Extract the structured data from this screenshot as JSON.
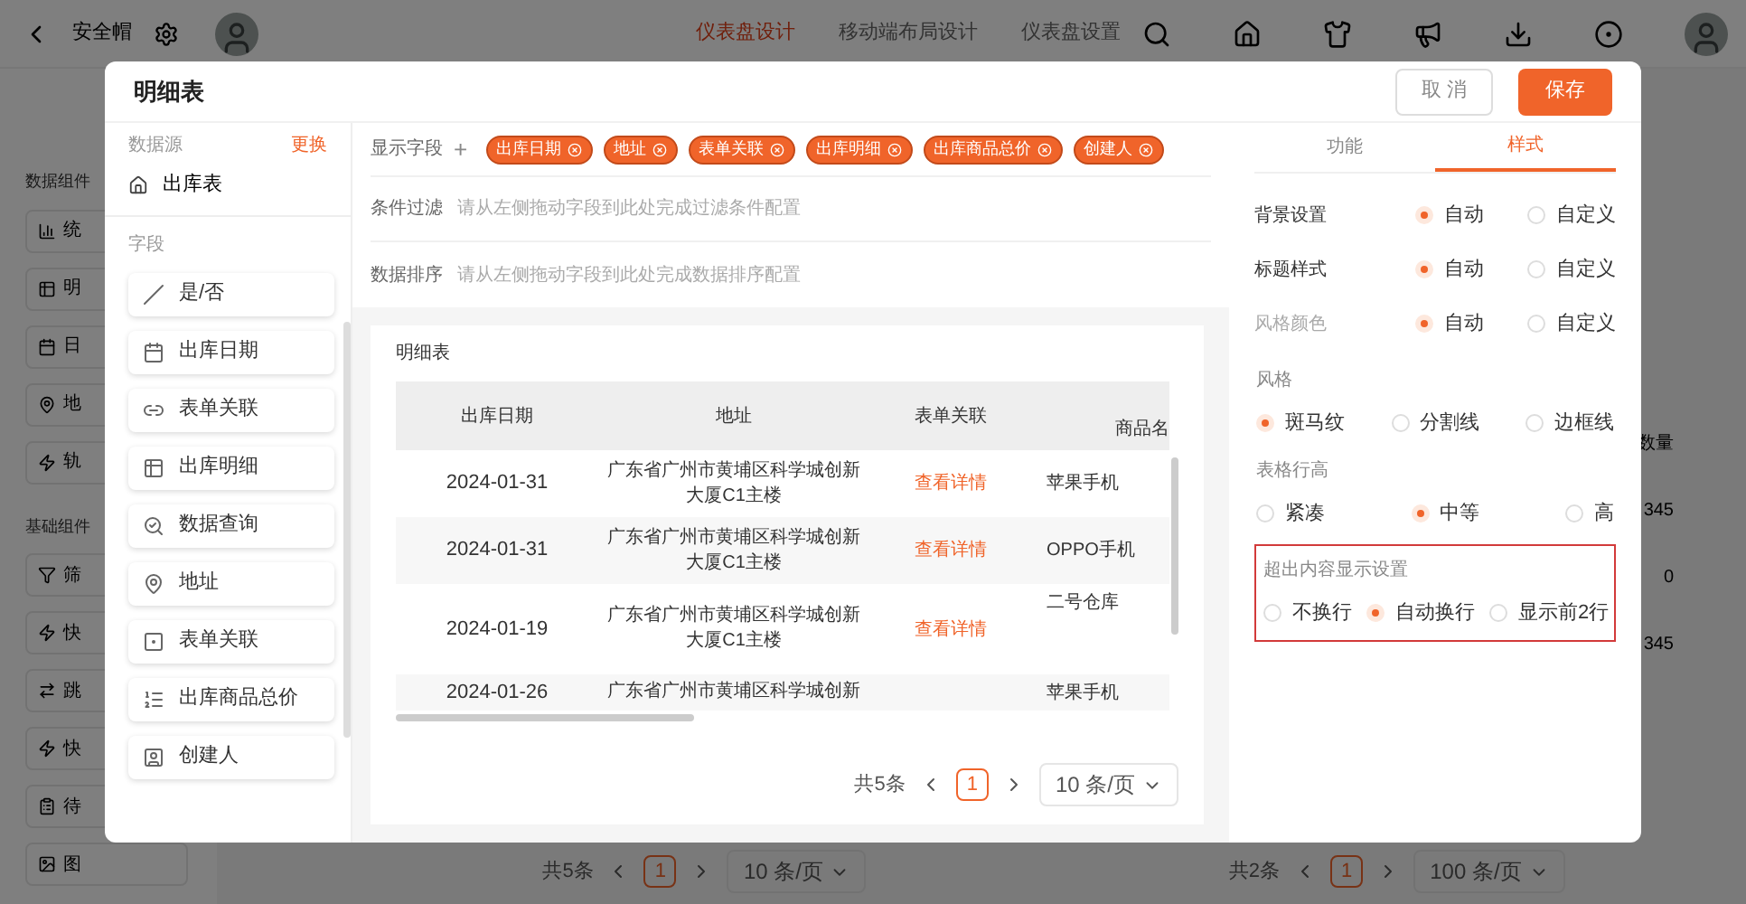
{
  "top_bar": {
    "title": "安全帽",
    "tabs": [
      {
        "label": "仪表盘设计",
        "selected": true
      },
      {
        "label": "移动端布局设计",
        "selected": false
      },
      {
        "label": "仪表盘设置",
        "selected": false
      }
    ]
  },
  "background_sidebar": {
    "sections": [
      {
        "title": "数据组件",
        "items": [
          "统",
          "明",
          "日",
          "地",
          "轨"
        ]
      },
      {
        "title": "基础组件",
        "items": [
          "筛",
          "快",
          "跳",
          "快",
          "待",
          "图"
        ]
      }
    ]
  },
  "background_table": {
    "column_header": "数量",
    "values": [
      "345",
      "0",
      "345"
    ]
  },
  "background_paginations": [
    {
      "total": "共5条",
      "page": "1",
      "size": "10 条/页"
    },
    {
      "total": "共2条",
      "page": "1",
      "size": "100 条/页"
    }
  ],
  "modal": {
    "title": "明细表",
    "cancel": "取 消",
    "save": "保存"
  },
  "datasource": {
    "label": "数据源",
    "action": "更换",
    "table": "出库表"
  },
  "fields": {
    "label": "字段",
    "items": [
      {
        "kind": "boolean",
        "label": "是/否"
      },
      {
        "kind": "date",
        "label": "出库日期"
      },
      {
        "kind": "relation",
        "label": "表单关联"
      },
      {
        "kind": "detail",
        "label": "出库明细"
      },
      {
        "kind": "query",
        "label": "数据查询"
      },
      {
        "kind": "address",
        "label": "地址"
      },
      {
        "kind": "form",
        "label": "表单关联"
      },
      {
        "kind": "number",
        "label": "出库商品总价"
      },
      {
        "kind": "user",
        "label": "创建人"
      }
    ]
  },
  "config": {
    "display": {
      "label": "显示字段",
      "add": "+",
      "tags": [
        "出库日期",
        "地址",
        "表单关联",
        "出库明细",
        "出库商品总价",
        "创建人"
      ]
    },
    "filter": {
      "label": "条件过滤",
      "placeholder": "请从左侧拖动字段到此处完成过滤条件配置"
    },
    "sort": {
      "label": "数据排序",
      "placeholder": "请从左侧拖动字段到此处完成数据排序配置"
    }
  },
  "preview": {
    "title": "明细表",
    "columns": [
      "出库日期",
      "地址",
      "表单关联",
      "商品名"
    ],
    "rows": [
      {
        "date": "2024-01-31",
        "address": "广东省广州市黄埔区科学城创新大厦C1主楼",
        "link": "查看详情",
        "product": "苹果手机"
      },
      {
        "date": "2024-01-31",
        "address": "广东省广州市黄埔区科学城创新大厦C1主楼",
        "link": "查看详情",
        "product": "OPPO手机"
      },
      {
        "date": "2024-01-19",
        "address": "广东省广州市黄埔区科学城创新大厦C1主楼",
        "link": "查看详情",
        "product": "二号仓库"
      },
      {
        "date": "2024-01-26",
        "address": "广东省广州市黄埔区科学城创新",
        "link": "",
        "product": "苹果手机"
      }
    ],
    "pagination": {
      "total": "共5条",
      "page": "1",
      "size": "10 条/页"
    }
  },
  "style_panel": {
    "tabs": [
      {
        "label": "功能",
        "selected": false
      },
      {
        "label": "样式",
        "selected": true
      }
    ],
    "settings": [
      {
        "kind": "inline",
        "label": "背景设置",
        "disabled": false,
        "options": [
          {
            "label": "自动",
            "selected": true
          },
          {
            "label": "自定义",
            "selected": false
          }
        ]
      },
      {
        "kind": "inline",
        "label": "标题样式",
        "disabled": false,
        "options": [
          {
            "label": "自动",
            "selected": true
          },
          {
            "label": "自定义",
            "selected": false
          }
        ]
      },
      {
        "kind": "inline",
        "label": "风格颜色",
        "disabled": true,
        "options": [
          {
            "label": "自动",
            "selected": true
          },
          {
            "label": "自定义",
            "selected": false
          }
        ]
      },
      {
        "kind": "stacked",
        "label": "风格",
        "highlighted": false,
        "options": [
          {
            "label": "斑马纹",
            "selected": true
          },
          {
            "label": "分割线",
            "selected": false
          },
          {
            "label": "边框线",
            "selected": false
          }
        ]
      },
      {
        "kind": "stacked",
        "label": "表格行高",
        "highlighted": false,
        "options": [
          {
            "label": "紧凑",
            "selected": false
          },
          {
            "label": "中等",
            "selected": true
          },
          {
            "label": "高",
            "selected": false
          }
        ]
      },
      {
        "kind": "stacked",
        "label": "超出内容显示设置",
        "highlighted": true,
        "options": [
          {
            "label": "不换行",
            "selected": false
          },
          {
            "label": "自动换行",
            "selected": true
          },
          {
            "label": "显示前2行",
            "selected": false
          }
        ]
      }
    ]
  }
}
